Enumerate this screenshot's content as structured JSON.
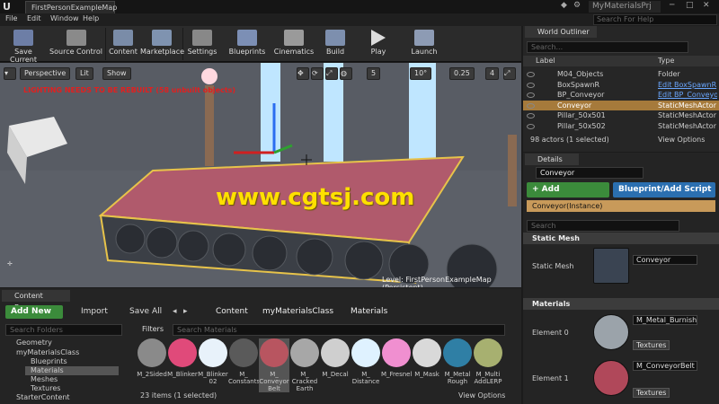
{
  "window": {
    "tab_title": "FirstPersonExampleMap",
    "project": "MyMaterialsPrj",
    "search_help": "Search For Help"
  },
  "menu": [
    "File",
    "Edit",
    "Window",
    "Help"
  ],
  "toolbar": [
    {
      "label": "Save Current",
      "icon": "save-icon"
    },
    {
      "label": "Source Control",
      "icon": "source-control-icon"
    },
    {
      "label": "Content",
      "icon": "content-icon"
    },
    {
      "label": "Marketplace",
      "icon": "marketplace-icon"
    },
    {
      "label": "Settings",
      "icon": "settings-icon"
    },
    {
      "label": "Blueprints",
      "icon": "blueprints-icon"
    },
    {
      "label": "Cinematics",
      "icon": "cinematics-icon"
    },
    {
      "label": "Build",
      "icon": "build-icon"
    },
    {
      "label": "Play",
      "icon": "play-icon"
    },
    {
      "label": "Launch",
      "icon": "launch-icon"
    }
  ],
  "viewport": {
    "perspective": "Perspective",
    "lit": "Lit",
    "show": "Show",
    "lighting_warning": "LIGHTING NEEDS TO BE REBUILT (58 unbuilt objects)",
    "grid_snap": "5",
    "angle_snap": "10°",
    "scale_snap": "0.25",
    "camera_speed": "4",
    "level_label": "Level:  FirstPersonExampleMap (Persistent)",
    "watermark": "www.cgtsj.com"
  },
  "outliner": {
    "tab": "World Outliner",
    "search_placeholder": "Search...",
    "col_label": "Label",
    "col_type": "Type",
    "rows": [
      {
        "label": "M04_Objects",
        "type": "Folder",
        "link": false
      },
      {
        "label": "BoxSpawnR",
        "type": "Edit BoxSpawnR",
        "link": true
      },
      {
        "label": "BP_Conveyor",
        "type": "Edit BP_Conveyor",
        "link": true
      },
      {
        "label": "Conveyor",
        "type": "StaticMeshActor",
        "link": false,
        "selected": true
      },
      {
        "label": "Pillar_50x501",
        "type": "StaticMeshActor",
        "link": false
      },
      {
        "label": "Pillar_50x502",
        "type": "StaticMeshActor",
        "link": false
      }
    ],
    "status": "98 actors (1 selected)",
    "view_options": "View Options"
  },
  "details": {
    "tab": "Details",
    "name_value": "Conveyor",
    "add_component": "+ Add Component",
    "blueprint_script": "Blueprint/Add Script",
    "instance": "Conveyor(Instance)",
    "search_placeholder": "Search",
    "static_mesh_section": "Static Mesh",
    "static_mesh_label": "Static Mesh",
    "static_mesh_value": "Conveyor",
    "materials_section": "Materials",
    "element0_label": "Element 0",
    "element0_value": "M_Metal_Burnished_",
    "element1_label": "Element 1",
    "element1_value": "M_ConveyorBelt",
    "textures_btn": "Textures"
  },
  "content_browser": {
    "tab": "Content Browser",
    "add_new": "Add New",
    "import": "Import",
    "save_all": "Save All",
    "path": [
      "Content",
      "myMaterialsClass",
      "Materials"
    ],
    "search_folders": "Search Folders",
    "filters": "Filters",
    "search_materials": "Search Materials",
    "tree": [
      {
        "label": "Geometry",
        "indent": 1
      },
      {
        "label": "myMaterialsClass",
        "indent": 1
      },
      {
        "label": "Blueprints",
        "indent": 2
      },
      {
        "label": "Materials",
        "indent": 2,
        "selected": true
      },
      {
        "label": "Meshes",
        "indent": 2
      },
      {
        "label": "Textures",
        "indent": 2
      },
      {
        "label": "StarterContent",
        "indent": 1
      }
    ],
    "assets": [
      {
        "name": "M_2Sided",
        "color": "#8a8a8a"
      },
      {
        "name": "M_Blinker",
        "color": "#e04a7a"
      },
      {
        "name": "M_Blinker 02",
        "color": "#e8f2fa"
      },
      {
        "name": "M_ Constants",
        "color": "#5a5a5a"
      },
      {
        "name": "M_ Conveyor Belt",
        "color": "#b85560",
        "selected": true
      },
      {
        "name": "M_ Cracked Earth",
        "color": "#a7a7a7"
      },
      {
        "name": "M_Decal",
        "color": "#cfcfcf"
      },
      {
        "name": "M_ Distance",
        "color": "#dff2ff"
      },
      {
        "name": "M_Fresnel",
        "color": "#f08fd0"
      },
      {
        "name": "M_Mask",
        "color": "#d9d9d9"
      },
      {
        "name": "M_Metal Rough",
        "color": "#2f7fa5"
      },
      {
        "name": "M_Multi AddLERP",
        "color": "#a7b070"
      }
    ],
    "status": "23 items (1 selected)",
    "view_options": "View Options"
  }
}
